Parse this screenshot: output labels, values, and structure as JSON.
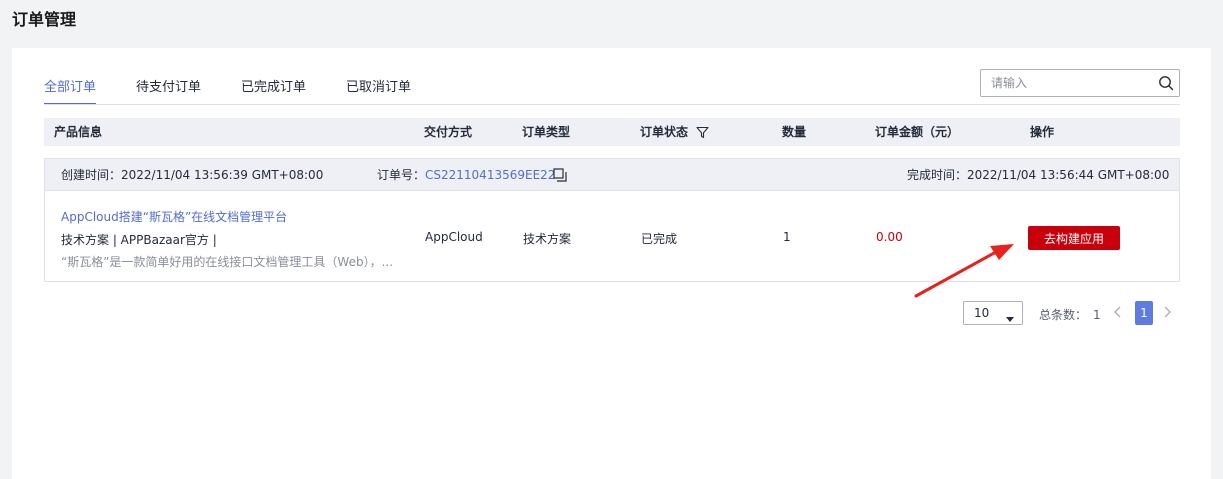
{
  "page": {
    "title": "订单管理"
  },
  "tabs": [
    {
      "label": "全部订单",
      "active": true
    },
    {
      "label": "待支付订单",
      "active": false
    },
    {
      "label": "已完成订单",
      "active": false
    },
    {
      "label": "已取消订单",
      "active": false
    }
  ],
  "search": {
    "placeholder": "请输入",
    "value": ""
  },
  "table": {
    "columns": [
      "产品信息",
      "交付方式",
      "订单类型",
      "订单状态",
      "数量",
      "订单金额（元）",
      "操作"
    ]
  },
  "order": {
    "created_label": "创建时间：",
    "created_time": "2022/11/04 13:56:39 GMT+08:00",
    "order_no_label": "订单号：",
    "order_no": "CS22110413569EE22",
    "completed_label": "完成时间：",
    "completed_time": "2022/11/04 13:56:44 GMT+08:00",
    "product_title": "AppCloud搭建“斯瓦格”在线文档管理平台",
    "product_meta": "技术方案 | APPBazaar官方 |",
    "product_desc": "“斯瓦格”是一款简单好用的在线接口文档管理工具（Web），...",
    "delivery": "AppCloud",
    "type": "技术方案",
    "status": "已完成",
    "quantity": "1",
    "amount": "0.00",
    "action_label": "去构建应用"
  },
  "pagination": {
    "page_size": "10",
    "total_label": "总条数：",
    "total": "1",
    "current_page": "1"
  },
  "colors": {
    "accent": "#526ecc",
    "danger": "#c7000b",
    "annotation_arrow": "#e8211d"
  }
}
